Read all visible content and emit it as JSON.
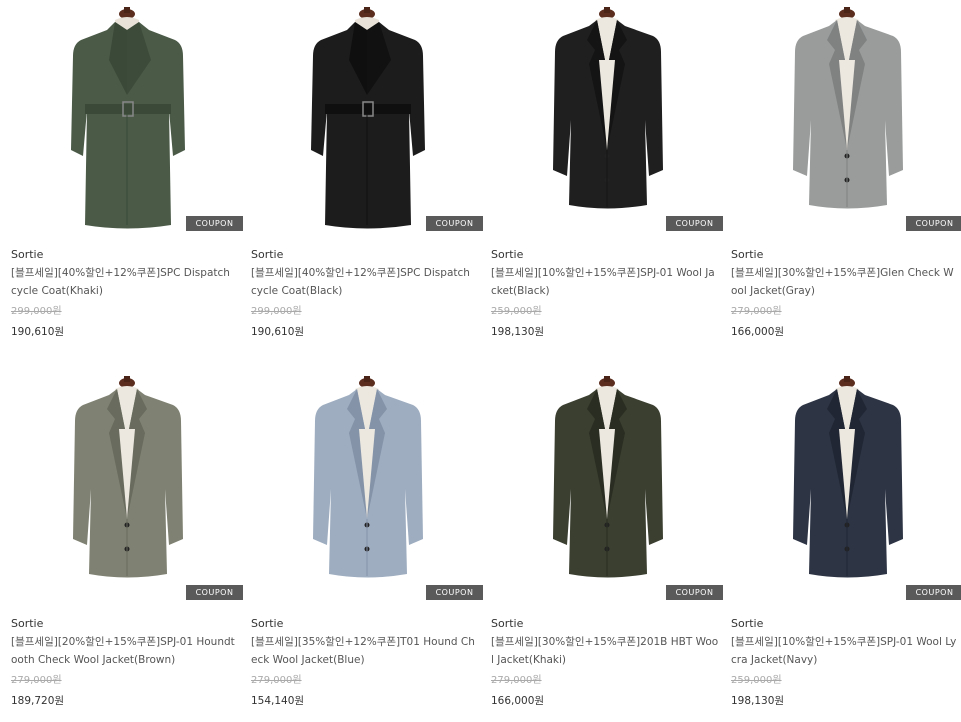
{
  "coupon_label": "COUPON",
  "products": [
    {
      "brand": "Sortie",
      "title": "[블프세일][40%할인+12%쿠폰]SPC Dispatch cycle Coat(Khaki)",
      "original_price": "299,000원",
      "sale_price": "190,610원",
      "garment": "trench",
      "color": "#4a5a47",
      "accent": "#3b4a38",
      "inner": "#e8e2d8"
    },
    {
      "brand": "Sortie",
      "title": "[블프세일][40%할인+12%쿠폰]SPC Dispatch cycle Coat(Black)",
      "original_price": "299,000원",
      "sale_price": "190,610원",
      "garment": "trench",
      "color": "#1c1c1c",
      "accent": "#0f0f0f",
      "inner": "#e8e2d8"
    },
    {
      "brand": "Sortie",
      "title": "[블프세일][10%할인+15%쿠폰]SPJ-01 Wool Jacket(Black)",
      "original_price": "259,000원",
      "sale_price": "198,130원",
      "garment": "jacket",
      "color": "#1f1f1f",
      "accent": "#141414",
      "inner": "#ece8e0"
    },
    {
      "brand": "Sortie",
      "title": "[블프세일][30%할인+15%쿠폰]Glen Check Wool Jacket(Gray)",
      "original_price": "279,000원",
      "sale_price": "166,000원",
      "garment": "jacket",
      "color": "#9a9c9c",
      "accent": "#808282",
      "inner": "#ece8e0"
    },
    {
      "brand": "Sortie",
      "title": "[블프세일][20%할인+15%쿠폰]SPJ-01 Houndtooth Check Wool Jacket(Brown)",
      "original_price": "279,000원",
      "sale_price": "189,720원",
      "garment": "jacket",
      "color": "#7f8272",
      "accent": "#686b5d",
      "inner": "#ece8e0"
    },
    {
      "brand": "Sortie",
      "title": "[블프세일][35%할인+12%쿠폰]T01 Hound Check Wool Jacket(Blue)",
      "original_price": "279,000원",
      "sale_price": "154,140원",
      "garment": "jacket",
      "color": "#9eadc0",
      "accent": "#8493a8",
      "inner": "#ece8e0"
    },
    {
      "brand": "Sortie",
      "title": "[블프세일][30%할인+15%쿠폰]201B HBT Wool Jacket(Khaki)",
      "original_price": "279,000원",
      "sale_price": "166,000원",
      "garment": "jacket",
      "color": "#3a3f30",
      "accent": "#2a2e22",
      "inner": "#ece8e0"
    },
    {
      "brand": "Sortie",
      "title": "[블프세일][10%할인+15%쿠폰]SPJ-01 Wool Lycra Jacket(Navy)",
      "original_price": "259,000원",
      "sale_price": "198,130원",
      "garment": "jacket",
      "color": "#2d3444",
      "accent": "#202633",
      "inner": "#ece8e0"
    }
  ]
}
